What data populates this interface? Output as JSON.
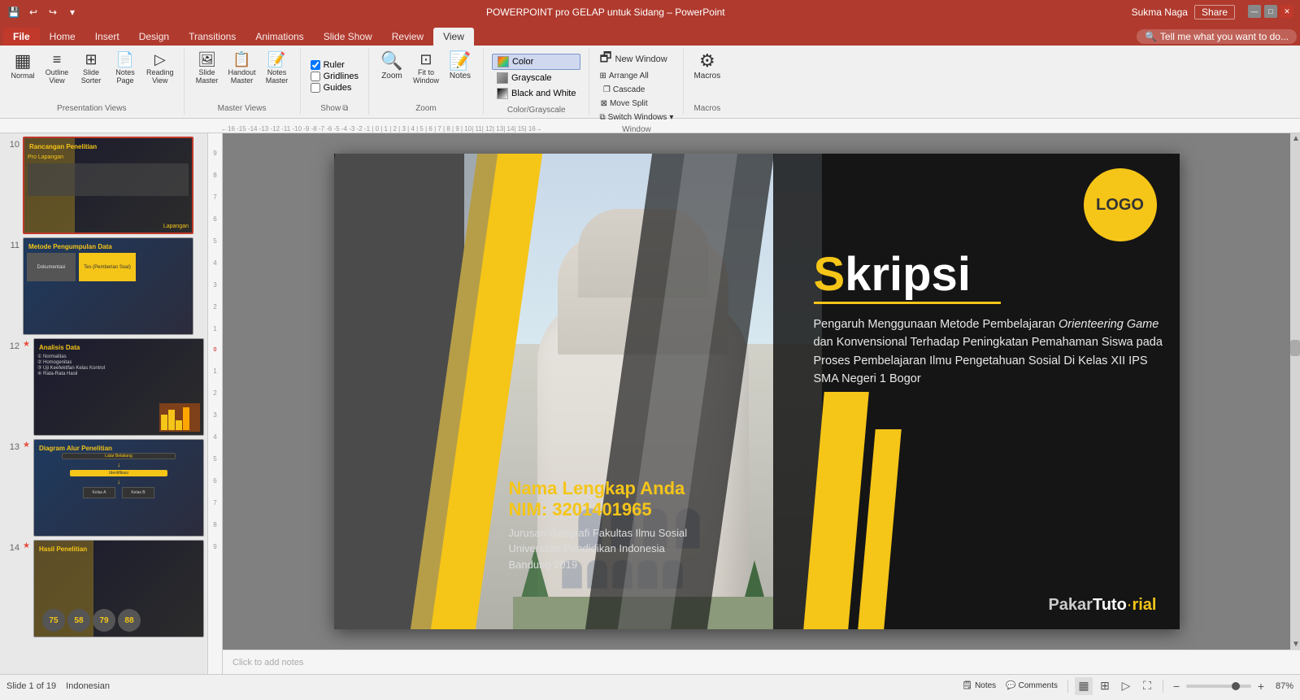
{
  "titlebar": {
    "title": "POWERPOINT pro GELAP untuk Sidang – PowerPoint",
    "user": "Sukma Naga",
    "share_label": "Share"
  },
  "ribbon_tabs": {
    "items": [
      "File",
      "Home",
      "Insert",
      "Design",
      "Transitions",
      "Animations",
      "Slide Show",
      "Review",
      "View"
    ]
  },
  "tell_me": {
    "placeholder": "Tell me what you want to do..."
  },
  "ribbon_view": {
    "presentation_views": {
      "label": "Presentation Views",
      "normal_label": "Normal",
      "outline_view_label": "Outline View",
      "slide_sorter_label": "Slide Sorter",
      "notes_page_label": "Notes Page",
      "reading_view_label": "Reading View"
    },
    "master_views": {
      "label": "Master Views",
      "slide_master_label": "Slide Master",
      "handout_master_label": "Handout Master",
      "notes_master_label": "Notes Master"
    },
    "show": {
      "label": "Show",
      "ruler_label": "Ruler",
      "gridlines_label": "Gridlines",
      "guides_label": "Guides",
      "ruler_checked": true,
      "gridlines_checked": false,
      "guides_checked": false
    },
    "zoom": {
      "label": "Zoom",
      "zoom_label": "Zoom",
      "fit_to_window_label": "Fit to Window",
      "notes_label": "Notes"
    },
    "color_grayscale": {
      "label": "Color/Grayscale",
      "color_label": "Color",
      "grayscale_label": "Grayscale",
      "black_white_label": "Black and White"
    },
    "window": {
      "label": "Window",
      "arrange_all_label": "Arrange All",
      "cascade_label": "Cascade",
      "move_split_label": "Move Split",
      "new_window_label": "New Window",
      "switch_windows_label": "Switch Windows"
    },
    "macros": {
      "label": "Macros",
      "macros_label": "Macros"
    }
  },
  "slide_panel": {
    "slides": [
      {
        "num": "10",
        "label": "Rancangan Penelitian",
        "color": "s10"
      },
      {
        "num": "11",
        "label": "Metode Pengumpulan Data",
        "color": "s11"
      },
      {
        "num": "12",
        "label": "Analisis Data",
        "color": "s12",
        "star": true
      },
      {
        "num": "13",
        "label": "Diagram Alur Penelitian",
        "color": "s13",
        "star": true
      },
      {
        "num": "14",
        "label": "Hasil Penelitian",
        "color": "s14",
        "star": true
      }
    ]
  },
  "slide": {
    "logo_text": "LOGO",
    "title_s": "S",
    "title_rest": "kripsi",
    "desc": "Pengaruh Menggunaan Metode Pembelajaran Orienteering Game dan Konvensional Terhadap Peningkatan Pemahaman Siswa pada Proses Pembelajaran Ilmu Pengetahuan Sosial Di Kelas XII IPS SMA Negeri 1 Bogor",
    "name": "Nama Lengkap Anda",
    "nim": "NIM: 3201401965",
    "dept": "Jurusan Geografi  Fakultas Ilmu Sosial",
    "univ": "Universitas Pendidikan Indonesia",
    "city_year": "Bandung 2019",
    "brand_pakar": "Pakar",
    "brand_tuto": "Tuto",
    "brand_rial": "rial"
  },
  "status_bar": {
    "slide_info": "Slide 1 of 19",
    "language": "Indonesian",
    "notes_label": "Notes",
    "comments_label": "Comments",
    "zoom_pct": "87%",
    "zoom_value": 87
  }
}
